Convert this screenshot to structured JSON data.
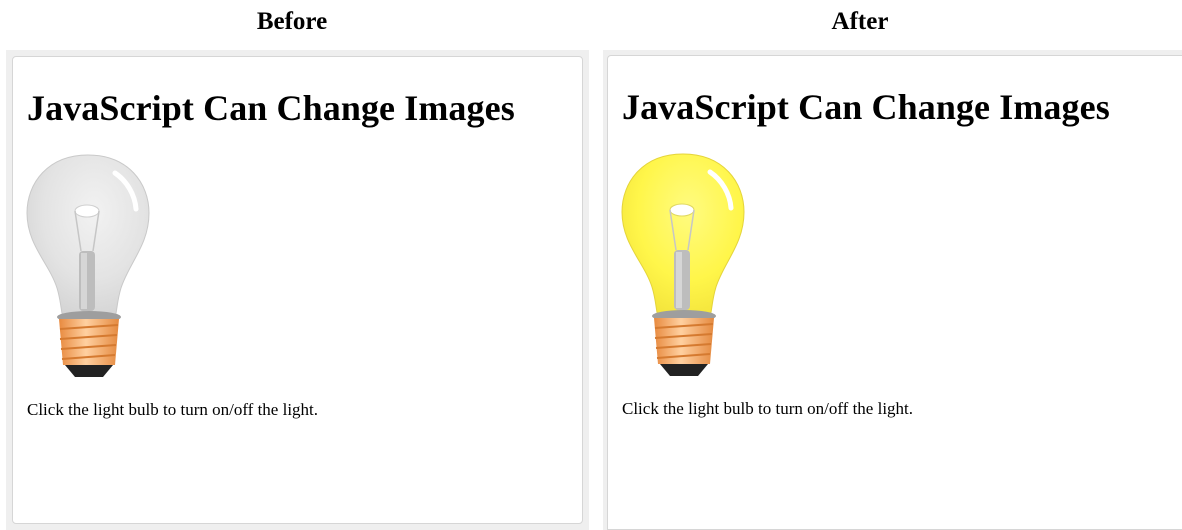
{
  "labels": {
    "before": "Before",
    "after": "After"
  },
  "demo": {
    "title": "JavaScript Can Change Images",
    "instruction": "Click the light bulb to turn on/off the light."
  },
  "panels": [
    {
      "state": "off",
      "bulb_color": "#e6e6e6",
      "icon": "lightbulb-off-icon"
    },
    {
      "state": "on",
      "bulb_color": "#fff64a",
      "icon": "lightbulb-on-icon"
    }
  ],
  "colors": {
    "bulb_off": "#e6e6e6",
    "bulb_on": "#fff64a",
    "base": "#f5a964",
    "frame_border": "#d6d6d6",
    "panel_bg": "#efefef"
  }
}
